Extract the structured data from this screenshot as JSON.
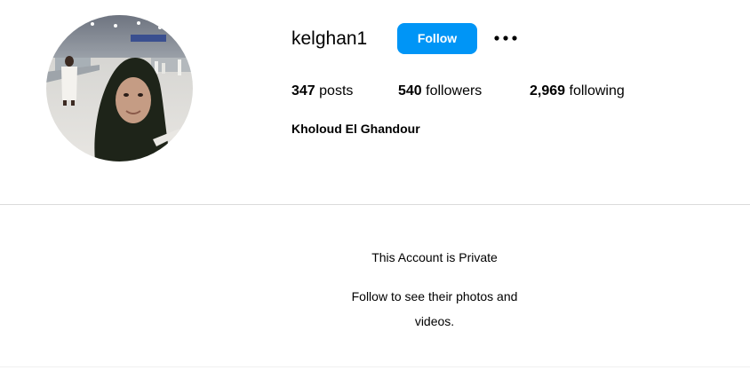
{
  "profile": {
    "username": "kelghan1",
    "follow_label": "Follow",
    "more_icon": "more-horizontal-icon",
    "full_name": "Kholoud El Ghandour",
    "stats": {
      "posts_count": "347",
      "posts_label": "posts",
      "followers_count": "540",
      "followers_label": "followers",
      "following_count": "2,969",
      "following_label": "following"
    }
  },
  "private_notice": {
    "title": "This Account is Private",
    "subtitle": "Follow to see their photos and videos."
  },
  "colors": {
    "accent": "#0095f6",
    "divider": "#dbdbdb"
  }
}
